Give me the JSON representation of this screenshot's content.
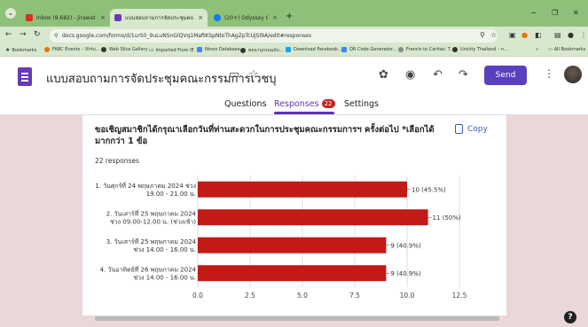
{
  "browser": {
    "tabs": [
      {
        "label": "Inbox (9,682) - jirawat@caritas",
        "active": false,
        "favicon_color": "#d93025"
      },
      {
        "label": "แบบสอบถามการจัดประชุมคณะกรรม",
        "active": true,
        "favicon_color": "#673ab7"
      },
      {
        "label": "(20+) Odyssey Club Thailand | ",
        "active": false,
        "favicon_color": "#1877f2"
      }
    ],
    "tab_close": "×",
    "new_tab": "+",
    "window_minimize": "−",
    "window_restore": "❐",
    "window_close": "✕",
    "url": "docs.google.com/forms/d/1urS0_9uLuNSnGlQVq1MaftKSpNtoThAgZpTcUjSl9A/edit#responses",
    "bookmarks": [
      {
        "label": "Bookmarks",
        "color": "#444"
      },
      {
        "label": "FABC Events – Virtu…",
        "color": "#e8710a"
      },
      {
        "label": "Web Slice Gallery",
        "color": "#333"
      },
      {
        "label": "Imported From IE",
        "color": "#888"
      },
      {
        "label": "Ninox Database",
        "color": "#4285f4"
      },
      {
        "label": "พจนานุกรมฉบับ…",
        "color": "#333"
      },
      {
        "label": "Download Facebook…",
        "color": "#1da1f2"
      },
      {
        "label": "QR Code Generator…",
        "color": "#4285f4"
      },
      {
        "label": "Francis to Caritas: T…",
        "color": "#888"
      },
      {
        "label": "Unicity Thailand – n…",
        "color": "#333"
      }
    ],
    "bookmarks_overflow": "»",
    "all_bookmarks": "All Bookmarks"
  },
  "form": {
    "title": "แบบสอบถามการจัดประชุมคณะกรรมการเวชบุ",
    "send_label": "Send",
    "tabs": {
      "questions": "Questions",
      "responses": "Responses",
      "responses_count": "22",
      "settings": "Settings"
    }
  },
  "question": {
    "title": "ขอเชิญสมาชิกได้กรุณาเลือกวันที่ท่านสะดวกในการประชุมคณะกรรมการฯ ครั้งต่อไป",
    "required_note": "*เลือกได้มากกว่า 1 ข้อ",
    "copy_label": "Copy",
    "responses_text": "22 responses"
  },
  "chart_data": {
    "type": "bar",
    "orientation": "horizontal",
    "categories": [
      [
        "1. วันศุกร์ที่ 24 พฤษภาคม 2024 ช่วง",
        "19.00 - 21.00 น."
      ],
      [
        "2. วันเสาร์ที่ 25 พฤษภาคม 2024",
        "ช่วง 09.00-12.00 น. (ช่วงเช้า)"
      ],
      [
        "3. วันเสาร์ที่ 25 พฤษภาคม 2024",
        "ช่วง 14.00 - 16.00 น."
      ],
      [
        "4. วันอาทิตย์ที่ 26 พฤษภาคม 2024",
        "ช่วง 14.00 - 16.00 น."
      ]
    ],
    "values": [
      10,
      11,
      9,
      9
    ],
    "data_labels": [
      "10 (45.5%)",
      "11 (50%)",
      "9 (40.9%)",
      "9 (40.9%)"
    ],
    "xlim": [
      0,
      12.5
    ],
    "xticks": [
      0,
      2.5,
      5,
      7.5,
      10,
      12.5
    ],
    "xtick_labels": [
      "0.0",
      "2.5",
      "5.0",
      "7.5",
      "10.0",
      "12.5"
    ],
    "grid": true,
    "bar_color": "#c21a17"
  }
}
